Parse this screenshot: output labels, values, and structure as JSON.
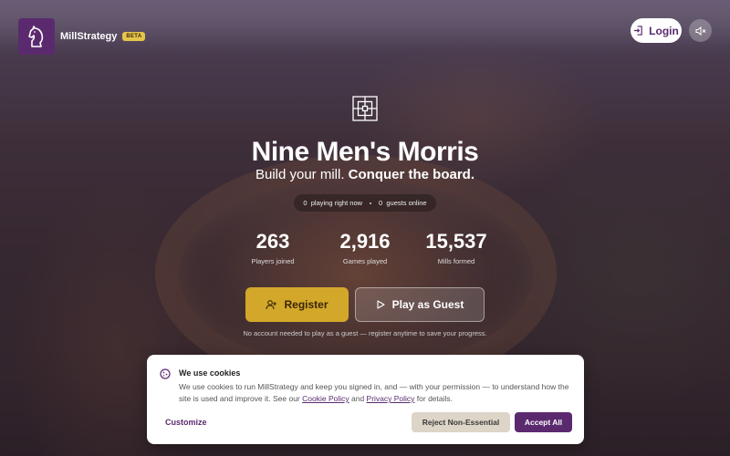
{
  "header": {
    "brand": "MillStrategy",
    "badge": "BETA",
    "login_label": "Login"
  },
  "hero": {
    "title": "Nine Men's Morris",
    "subtitle_plain": "Build your mill. ",
    "subtitle_bold": "Conquer the board.",
    "playing_count": "0",
    "playing_label": "playing right now",
    "guests_count": "0",
    "guests_label": "guests online"
  },
  "stats": [
    {
      "value": "263",
      "label": "Players joined"
    },
    {
      "value": "2,916",
      "label": "Games played"
    },
    {
      "value": "15,537",
      "label": "Mills formed"
    }
  ],
  "actions": {
    "register_label": "Register",
    "guest_label": "Play as Guest",
    "hint": "No account needed to play as a guest — register anytime to save your progress."
  },
  "cookie": {
    "title": "We use cookies",
    "text_before": "We use cookies to run MillStrategy and keep you signed in, and — with your permission — to understand how the site is used and improve it. See our ",
    "cookie_policy": "Cookie Policy",
    "and": " and ",
    "privacy_policy": "Privacy Policy",
    "text_after": " for details.",
    "customize_label": "Customize",
    "reject_label": "Reject Non-Essential",
    "accept_label": "Accept All"
  },
  "colors": {
    "brand_purple": "#5b2a6e",
    "gold": "#d3a82a",
    "badge_yellow": "#e6c44a"
  },
  "icons": {
    "logo": "knight-logo-icon",
    "login": "login-icon",
    "mute": "speaker-muted-icon",
    "board": "morris-board-icon",
    "register": "user-plus-icon",
    "guest": "play-icon",
    "cookie": "cookie-icon"
  }
}
